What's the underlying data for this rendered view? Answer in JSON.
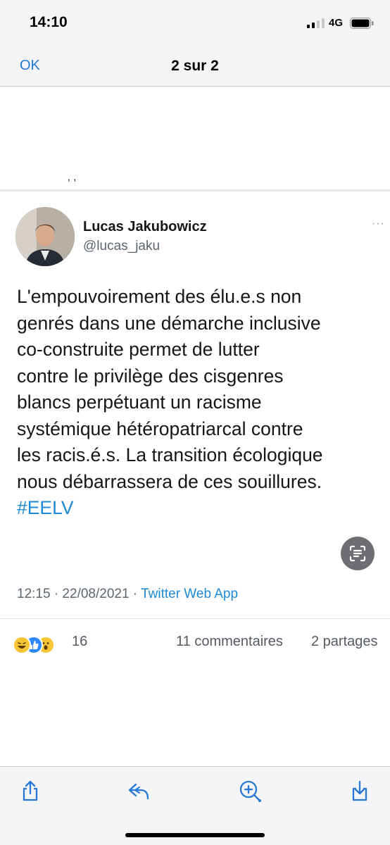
{
  "status_bar": {
    "time": "14:10",
    "network": "4G",
    "icons": [
      "signal-bars-icon",
      "battery-icon"
    ]
  },
  "nav": {
    "ok_label": "OK",
    "title": "2 sur 2"
  },
  "post": {
    "crop_mark": "‚ ,",
    "tweet": {
      "display_name": "Lucas Jakubowicz",
      "handle": "@lucas_jaku",
      "more": "···",
      "text": "L'empouvoirement des élu.e.s non\ngenrés dans une démarche inclusive\nco-construite permet de lutter\ncontre le privilège des cisgenres\nblancs perpétuant un racisme\nsystémique hétéropatriarcal contre\nles racis.é.s. La transition écologique\nnous débarrassera de ces souillures.",
      "hashtag": "#EELV",
      "timestamp": "12:15 · 22/08/2021 · ",
      "source": "Twitter Web App"
    },
    "reactions": {
      "icons": [
        "laughing-emoji-icon",
        "like-emoji-icon",
        "wow-emoji-icon"
      ],
      "count": "16",
      "comments": "11 commentaires",
      "shares": "2 partages"
    }
  },
  "toolbar": {
    "icons": [
      "share-icon",
      "reply-icon",
      "markup-icon",
      "save-icon"
    ]
  },
  "colors": {
    "accent": "#2478d8",
    "twitter_link": "#1d8ad6",
    "background": "#f5f5f7"
  }
}
